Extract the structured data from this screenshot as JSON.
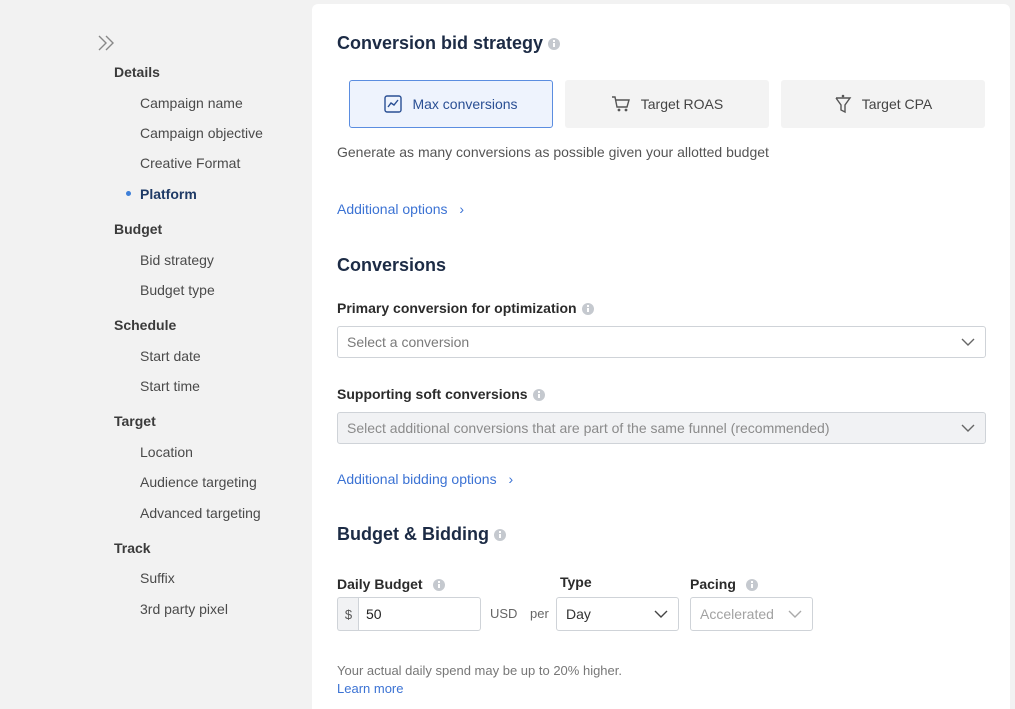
{
  "sidebar": {
    "groups": [
      {
        "label": "Details",
        "items": [
          "Campaign name",
          "Campaign objective",
          "Creative Format",
          "Platform"
        ]
      },
      {
        "label": "Budget",
        "items": [
          "Bid strategy",
          "Budget type"
        ]
      },
      {
        "label": "Schedule",
        "items": [
          "Start date",
          "Start time"
        ]
      },
      {
        "label": "Target",
        "items": [
          "Location",
          "Audience targeting",
          "Advanced targeting"
        ]
      },
      {
        "label": "Track",
        "items": [
          "Suffix",
          "3rd party pixel"
        ]
      }
    ],
    "active_item": "Platform"
  },
  "bid_strategy": {
    "title": "Conversion bid strategy",
    "options": [
      "Max conversions",
      "Target ROAS",
      "Target CPA"
    ],
    "selected": "Max conversions",
    "description": "Generate as many conversions as possible given your allotted budget",
    "additional_options": "Additional options"
  },
  "conversions": {
    "title": "Conversions",
    "primary_label": "Primary conversion for optimization",
    "primary_placeholder": "Select a conversion",
    "supporting_label": "Supporting soft conversions",
    "supporting_placeholder": "Select additional conversions that are part of the same funnel (recommended)",
    "additional_bidding": "Additional bidding options"
  },
  "budget": {
    "title": "Budget & Bidding",
    "daily_label": "Daily Budget",
    "currency_symbol": "$",
    "daily_value": "50",
    "currency": "USD",
    "per": "per",
    "type_label": "Type",
    "type_value": "Day",
    "pacing_label": "Pacing",
    "pacing_value": "Accelerated",
    "note": "Your actual daily spend may be up to 20% higher.",
    "learn_more": "Learn more"
  },
  "colors": {
    "accent": "#3c73d4",
    "selected_border": "#5b8de0"
  }
}
